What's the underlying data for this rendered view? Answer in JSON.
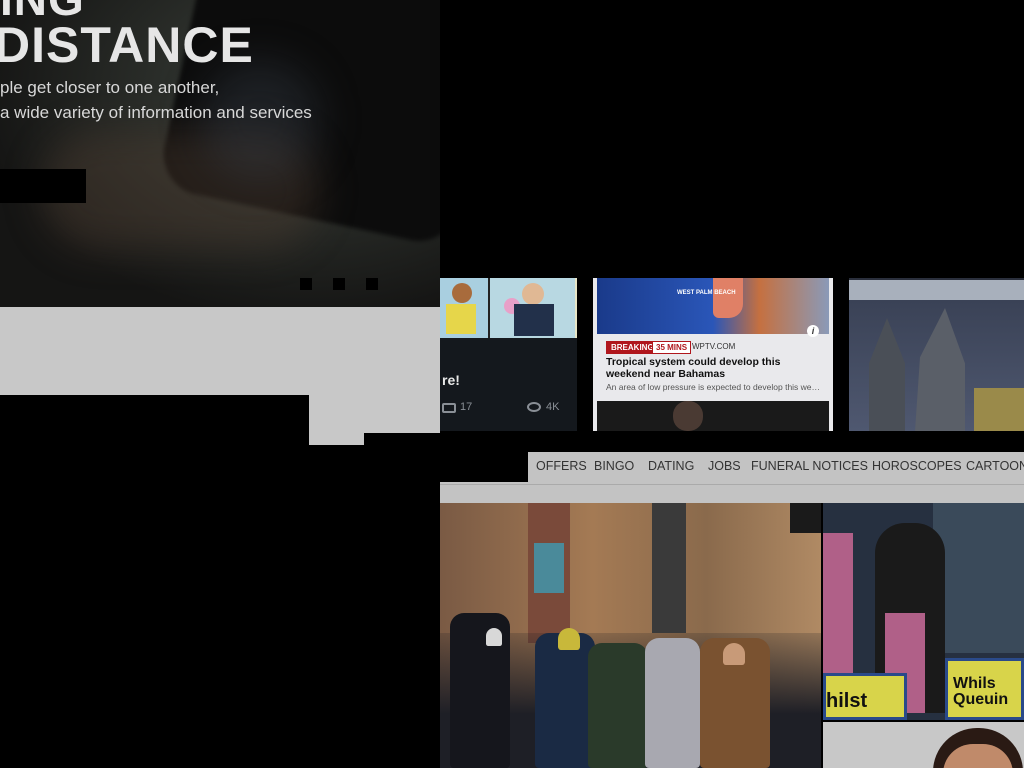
{
  "hero": {
    "title_top": "ING",
    "title": "DISTANCE",
    "subtitle_line1": "ple get closer to one another,",
    "subtitle_line2": "a wide variety of information and services"
  },
  "cards": [
    {
      "title": "re!",
      "comments": "17",
      "views": "4K"
    },
    {
      "map_label": "WEST PALM BEACH",
      "badge": "BREAKING",
      "time": "35 MINS",
      "source": "WPTV.COM",
      "title": "Tropical system could develop this weekend near Bahamas",
      "description": "An area of low pressure is expected to develop this week..."
    }
  ],
  "nav": {
    "items": [
      "OFFERS",
      "BINGO",
      "DATING",
      "JOBS",
      "FUNERAL NOTICES",
      "HOROSCOPES",
      "CARTOON"
    ]
  },
  "photos": {
    "sign1": "hilst",
    "sign2_line1": "Whils",
    "sign2_line2": "Queuin"
  },
  "colors": {
    "breaking_red": "#b0161c",
    "nav_bg": "#c3c3c3",
    "panel_gray": "#c8c8c8"
  }
}
